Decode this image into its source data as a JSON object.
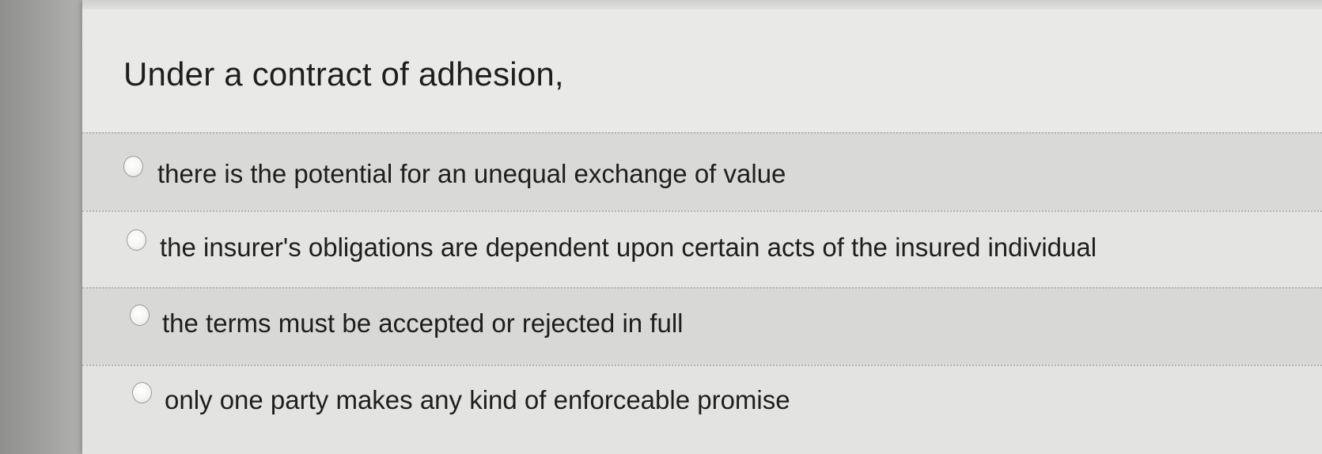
{
  "question": {
    "text": "Under a contract of adhesion,"
  },
  "options": [
    {
      "label": "there is the potential for an unequal exchange of value",
      "selected": false
    },
    {
      "label": "the insurer's obligations are dependent upon certain acts of the insured individual",
      "selected": false
    },
    {
      "label": "the terms must be accepted or rejected in full",
      "selected": false
    },
    {
      "label": "only one party makes any kind of enforceable promise",
      "selected": false
    }
  ]
}
